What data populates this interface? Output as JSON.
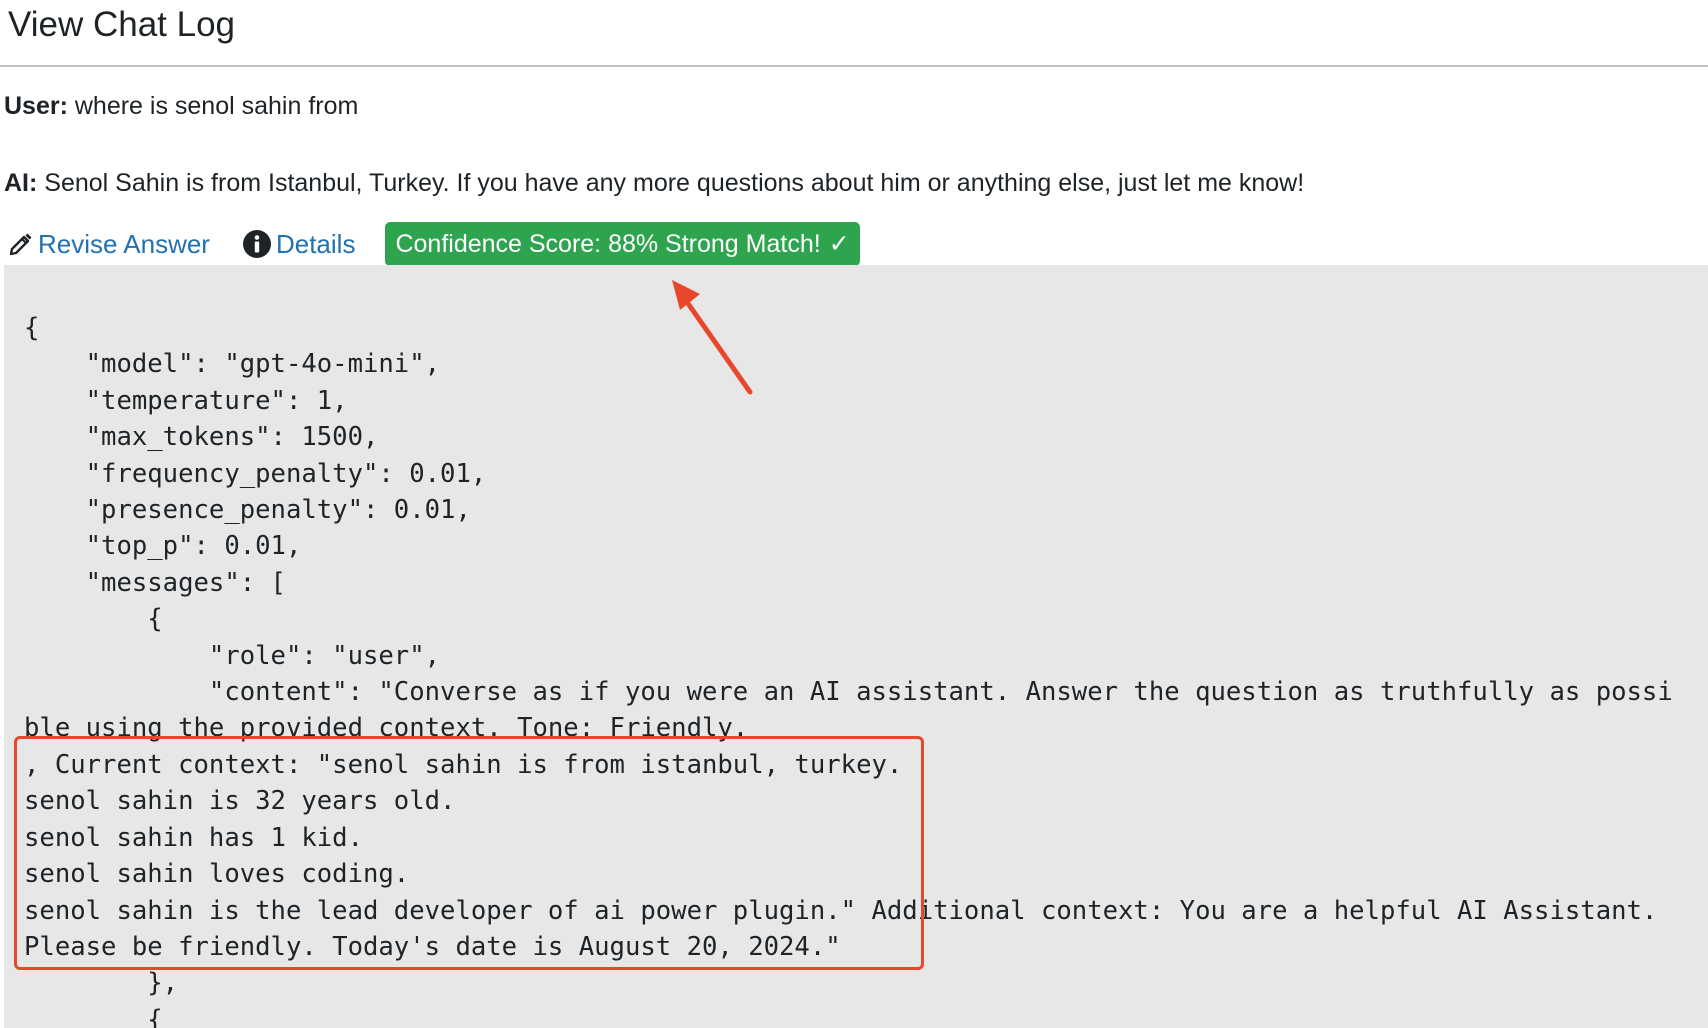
{
  "page": {
    "title": "View Chat Log"
  },
  "chat": {
    "user_label": "User:",
    "user_message": " where is senol sahin from",
    "ai_label": "AI:",
    "ai_message": " Senol Sahin is from Istanbul, Turkey. If you have any more questions about him or anything else, just let me know!"
  },
  "actions": {
    "revise_label": "Revise Answer",
    "details_label": "Details",
    "confidence_label": "Confidence Score: 88% Strong Match!",
    "confidence_check": "✓"
  },
  "code": {
    "lines": [
      "{",
      "    \"model\": \"gpt-4o-mini\",",
      "    \"temperature\": 1,",
      "    \"max_tokens\": 1500,",
      "    \"frequency_penalty\": 0.01,",
      "    \"presence_penalty\": 0.01,",
      "    \"top_p\": 0.01,",
      "    \"messages\": [",
      "        {",
      "            \"role\": \"user\",",
      "            \"content\": \"Converse as if you were an AI assistant. Answer the question as truthfully as possi",
      "ble using the provided context. Tone: Friendly.",
      ", Current context: \"senol sahin is from istanbul, turkey.",
      "senol sahin is 32 years old.",
      "senol sahin has 1 kid.",
      "senol sahin loves coding.",
      "senol sahin is the lead developer of ai power plugin.\" Additional context: You are a helpful AI Assistant.",
      "Please be friendly. Today's date is August 20, 2024.\"",
      "        },",
      "        {"
    ]
  },
  "colors": {
    "link": "#2271b1",
    "badge_bg": "#2ea44f",
    "annotation": "#e8472b",
    "code_bg": "#e7e7e7"
  },
  "icons": {
    "revise": "pencil-icon",
    "details": "info-icon",
    "confidence": "checkmark-icon"
  }
}
